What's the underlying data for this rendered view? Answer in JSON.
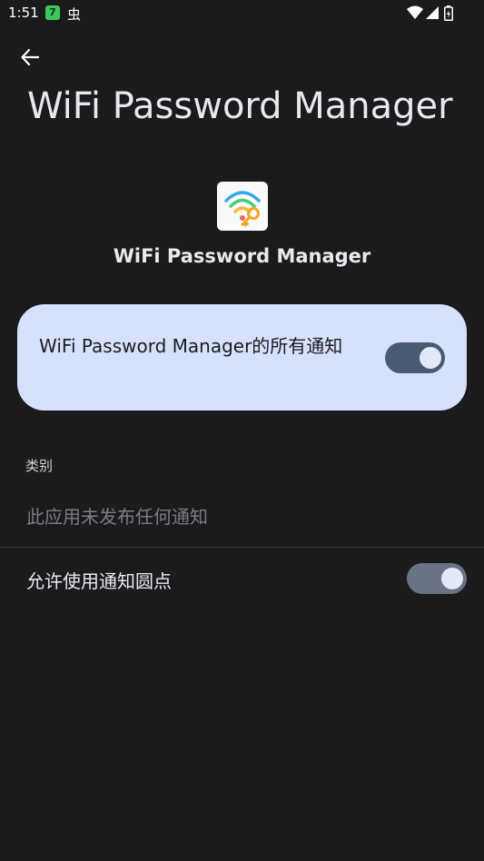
{
  "status_bar": {
    "time": "1:51",
    "notif_badge": "7",
    "notif_bug": "虫"
  },
  "header": {
    "title": "WiFi Password Manager"
  },
  "app": {
    "name": "WiFi Password Manager"
  },
  "master_toggle": {
    "label": "WiFi Password Manager的所有通知",
    "on": true
  },
  "category": {
    "header": "类别",
    "empty_message": "此应用未发布任何通知"
  },
  "notification_dots": {
    "label": "允许使用通知圆点",
    "on": true
  },
  "colors": {
    "background": "#1b1b1d",
    "card": "#d6e1fb",
    "switch_track": "#4a5a73",
    "switch_thumb": "#e2e8f6"
  }
}
